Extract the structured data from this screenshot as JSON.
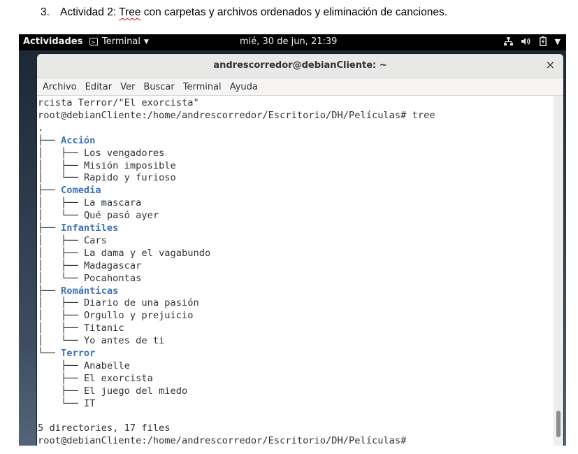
{
  "doc": {
    "item_number": "3.",
    "heading_pre": "Actividad 2: ",
    "heading_misspelled": "Tree",
    "heading_post": " con carpetas y archivos ordenados y eliminación de canciones."
  },
  "topbar": {
    "activities": "Actividades",
    "app_name": "Terminal",
    "clock": "mié, 30 de jun, 21:39",
    "tray_icons": [
      "network-icon",
      "volume-icon",
      "battery-icon",
      "system-menu-arrow-icon"
    ]
  },
  "window": {
    "title": "andrescorredor@debianCliente: ~",
    "close": "×"
  },
  "menubar": {
    "items": [
      "Archivo",
      "Editar",
      "Ver",
      "Buscar",
      "Terminal",
      "Ayuda"
    ]
  },
  "terminal": {
    "lines": [
      {
        "prefix": "",
        "text": "rcista Terror/\"El exorcista\"",
        "dir": false
      },
      {
        "prefix": "",
        "text": "root@debianCliente:/home/andrescorredor/Escritorio/DH/Películas# tree",
        "dir": false
      },
      {
        "prefix": "",
        "text": ".",
        "dir": true
      },
      {
        "prefix": "├── ",
        "text": "Acción",
        "dir": true
      },
      {
        "prefix": "│   ├── ",
        "text": "Los vengadores",
        "dir": false
      },
      {
        "prefix": "│   ├── ",
        "text": "Misión imposible",
        "dir": false
      },
      {
        "prefix": "│   └── ",
        "text": "Rapido y furioso",
        "dir": false
      },
      {
        "prefix": "├── ",
        "text": "Comedia",
        "dir": true
      },
      {
        "prefix": "│   ├── ",
        "text": "La mascara",
        "dir": false
      },
      {
        "prefix": "│   └── ",
        "text": "Qué pasó ayer",
        "dir": false
      },
      {
        "prefix": "├── ",
        "text": "Infantiles",
        "dir": true
      },
      {
        "prefix": "│   ├── ",
        "text": "Cars",
        "dir": false
      },
      {
        "prefix": "│   ├── ",
        "text": "La dama y el vagabundo",
        "dir": false
      },
      {
        "prefix": "│   ├── ",
        "text": "Madagascar",
        "dir": false
      },
      {
        "prefix": "│   └── ",
        "text": "Pocahontas",
        "dir": false
      },
      {
        "prefix": "├── ",
        "text": "Románticas",
        "dir": true
      },
      {
        "prefix": "│   ├── ",
        "text": "Diario de una pasión",
        "dir": false
      },
      {
        "prefix": "│   ├── ",
        "text": "Orgullo y prejuicio",
        "dir": false
      },
      {
        "prefix": "│   ├── ",
        "text": "Titanic",
        "dir": false
      },
      {
        "prefix": "│   └── ",
        "text": "Yo antes de ti",
        "dir": false
      },
      {
        "prefix": "└── ",
        "text": "Terror",
        "dir": true
      },
      {
        "prefix": "    ├── ",
        "text": "Anabelle",
        "dir": false
      },
      {
        "prefix": "    ├── ",
        "text": "El exorcista",
        "dir": false
      },
      {
        "prefix": "    ├── ",
        "text": "El juego del miedo",
        "dir": false
      },
      {
        "prefix": "    └── ",
        "text": "IT",
        "dir": false
      },
      {
        "prefix": "",
        "text": "",
        "dir": false
      },
      {
        "prefix": "",
        "text": "5 directories, 17 files",
        "dir": false
      },
      {
        "prefix": "",
        "text": "root@debianCliente:/home/andrescorredor/Escritorio/DH/Películas#",
        "dir": false
      }
    ]
  },
  "colors": {
    "directory": "#3f73b8",
    "terminal_text": "#2e3436",
    "topbar_bg": "#000000",
    "titlebar_bg": "#e8e8e7"
  }
}
